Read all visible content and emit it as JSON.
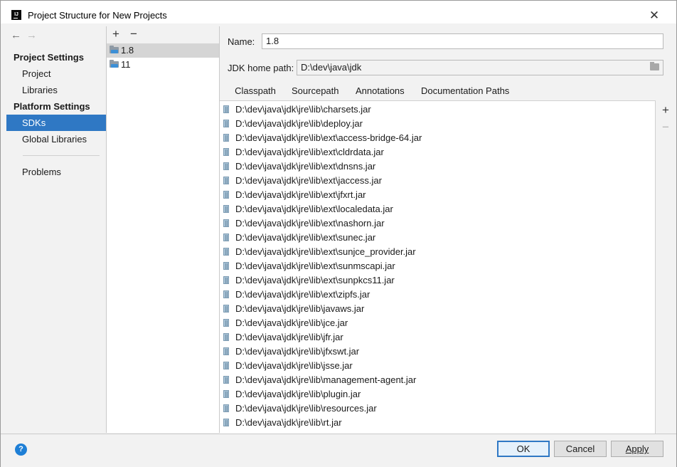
{
  "window": {
    "title": "Project Structure for New Projects",
    "app_icon": "IJ",
    "close_icon": "close-icon"
  },
  "nav": {
    "back_icon": "←",
    "forward_icon": "→",
    "project_settings_header": "Project Settings",
    "platform_settings_header": "Platform Settings",
    "items": [
      {
        "label": "Project"
      },
      {
        "label": "Libraries"
      },
      {
        "label": "SDKs",
        "selected": true
      },
      {
        "label": "Global Libraries"
      },
      {
        "label": "Problems"
      }
    ]
  },
  "sdk_list": {
    "add_icon": "+",
    "remove_icon": "−",
    "items": [
      {
        "label": "1.8",
        "selected": true
      },
      {
        "label": "11"
      }
    ]
  },
  "detail": {
    "name_label": "Name:",
    "name_value": "1.8",
    "home_label": "JDK home path:",
    "home_value": "D:\\dev\\java\\jdk",
    "tabs": [
      {
        "label": "Classpath",
        "selected": true
      },
      {
        "label": "Sourcepath"
      },
      {
        "label": "Annotations"
      },
      {
        "label": "Documentation Paths"
      }
    ],
    "classpath": [
      "D:\\dev\\java\\jdk\\jre\\lib\\charsets.jar",
      "D:\\dev\\java\\jdk\\jre\\lib\\deploy.jar",
      "D:\\dev\\java\\jdk\\jre\\lib\\ext\\access-bridge-64.jar",
      "D:\\dev\\java\\jdk\\jre\\lib\\ext\\cldrdata.jar",
      "D:\\dev\\java\\jdk\\jre\\lib\\ext\\dnsns.jar",
      "D:\\dev\\java\\jdk\\jre\\lib\\ext\\jaccess.jar",
      "D:\\dev\\java\\jdk\\jre\\lib\\ext\\jfxrt.jar",
      "D:\\dev\\java\\jdk\\jre\\lib\\ext\\localedata.jar",
      "D:\\dev\\java\\jdk\\jre\\lib\\ext\\nashorn.jar",
      "D:\\dev\\java\\jdk\\jre\\lib\\ext\\sunec.jar",
      "D:\\dev\\java\\jdk\\jre\\lib\\ext\\sunjce_provider.jar",
      "D:\\dev\\java\\jdk\\jre\\lib\\ext\\sunmscapi.jar",
      "D:\\dev\\java\\jdk\\jre\\lib\\ext\\sunpkcs11.jar",
      "D:\\dev\\java\\jdk\\jre\\lib\\ext\\zipfs.jar",
      "D:\\dev\\java\\jdk\\jre\\lib\\javaws.jar",
      "D:\\dev\\java\\jdk\\jre\\lib\\jce.jar",
      "D:\\dev\\java\\jdk\\jre\\lib\\jfr.jar",
      "D:\\dev\\java\\jdk\\jre\\lib\\jfxswt.jar",
      "D:\\dev\\java\\jdk\\jre\\lib\\jsse.jar",
      "D:\\dev\\java\\jdk\\jre\\lib\\management-agent.jar",
      "D:\\dev\\java\\jdk\\jre\\lib\\plugin.jar",
      "D:\\dev\\java\\jdk\\jre\\lib\\resources.jar",
      "D:\\dev\\java\\jdk\\jre\\lib\\rt.jar"
    ],
    "side_add_icon": "+",
    "side_remove_icon": "−"
  },
  "footer": {
    "help_icon": "?",
    "ok_label": "OK",
    "cancel_label": "Cancel",
    "apply_label": "Apply"
  },
  "colors": {
    "selection": "#2f78c4",
    "tab_underline": "#4083c9",
    "help": "#1e7fd6"
  }
}
